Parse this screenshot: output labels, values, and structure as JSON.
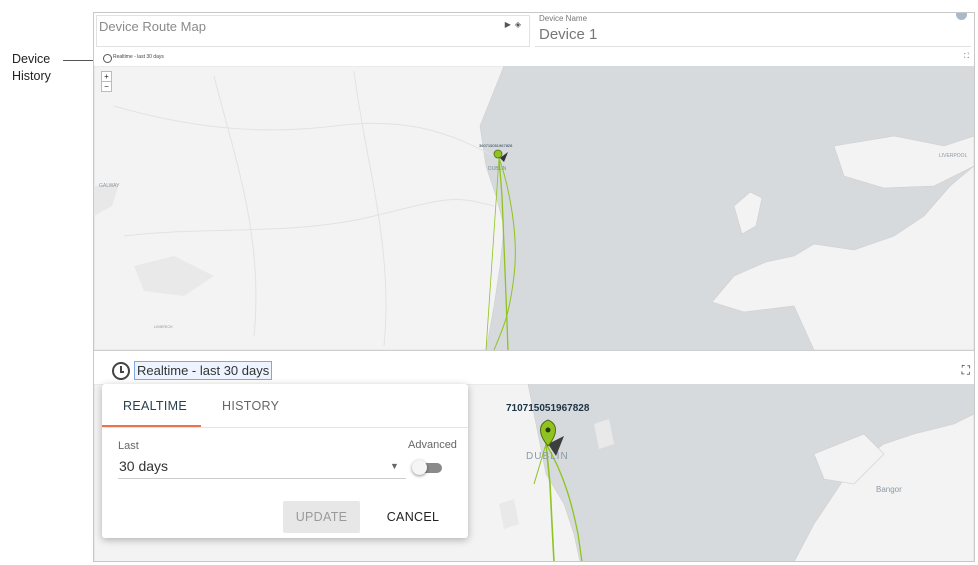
{
  "callout": {
    "line1": "Device",
    "line2": "History"
  },
  "header": {
    "title": "Device Route Map",
    "device_label": "Device Name",
    "device_value": "Device 1"
  },
  "mini_map": {
    "range_text": "Realtime - last 30 days",
    "device_id": "360715051967828",
    "labels": {
      "dublin": "DUBLIN",
      "galway": "GALWAY",
      "liverpool": "LIVERPOOL",
      "limerick": "LIMERICK"
    },
    "zoom_in": "+",
    "zoom_out": "−"
  },
  "main_map": {
    "range_text": "Realtime - last 30 days",
    "device_id": "710715051967828",
    "dublin": "DUBLIN",
    "bangor": "Bangor",
    "expand_icon": "fullscreen-icon"
  },
  "popup": {
    "tabs": [
      "REALTIME",
      "HISTORY"
    ],
    "active_tab": "REALTIME",
    "last_label": "Last",
    "last_value": "30 days",
    "advanced_label": "Advanced",
    "advanced_enabled": false,
    "update_label": "UPDATE",
    "cancel_label": "CANCEL"
  },
  "colors": {
    "accent_tab": "#e8734f",
    "route": "#8fc31f",
    "sea": "#d4d8dc",
    "land": "#f2f2f2"
  }
}
